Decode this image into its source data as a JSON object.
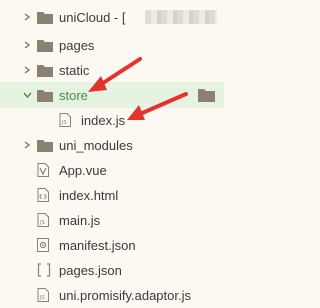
{
  "tree": {
    "root": {
      "label": "uniCloud - [",
      "icon": "folder-icon",
      "expanded": false
    },
    "items": [
      {
        "label": "pages",
        "icon": "folder-icon",
        "expanded": false
      },
      {
        "label": "static",
        "icon": "folder-icon",
        "expanded": false
      },
      {
        "label": "store",
        "icon": "folder-icon",
        "expanded": true
      },
      {
        "label": "index.js",
        "icon": "file-js-icon"
      },
      {
        "label": "uni_modules",
        "icon": "folder-icon",
        "expanded": false
      },
      {
        "label": "App.vue",
        "icon": "file-vue-icon"
      },
      {
        "label": "index.html",
        "icon": "file-html-icon"
      },
      {
        "label": "main.js",
        "icon": "file-js-icon"
      },
      {
        "label": "manifest.json",
        "icon": "file-json-icon"
      },
      {
        "label": "pages.json",
        "icon": "file-json-brackets-icon"
      },
      {
        "label": "uni.promisify.adaptor.js",
        "icon": "file-js-icon"
      }
    ]
  },
  "colors": {
    "background": "#fbf9f1",
    "selected_row": "#e7f3e2",
    "selected_text": "#3f8f3f",
    "folder": "#8a8172",
    "arrow": "#e5322d"
  }
}
